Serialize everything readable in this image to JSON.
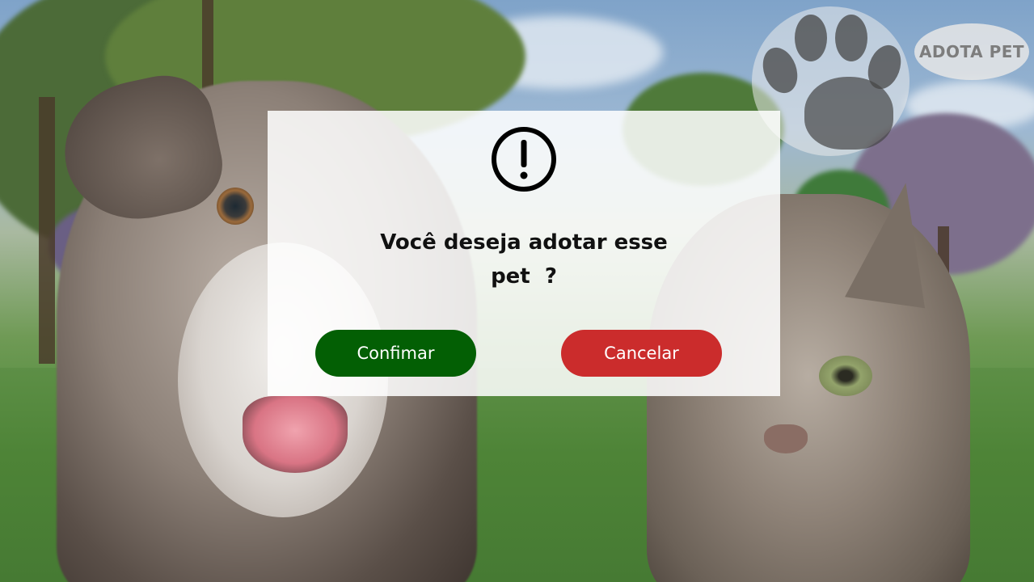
{
  "logo": {
    "text": "ADOTA PET",
    "icon": "paw-icon"
  },
  "dialog": {
    "icon": "exclamation-circle-icon",
    "question_line1": "Você deseja adotar esse",
    "question_line2": "pet  ?",
    "confirm_label": "Confimar",
    "cancel_label": "Cancelar"
  },
  "colors": {
    "confirm": "#035f04",
    "cancel": "#cb2c2c",
    "dialog_bg": "#ffffff",
    "text": "#111111"
  }
}
